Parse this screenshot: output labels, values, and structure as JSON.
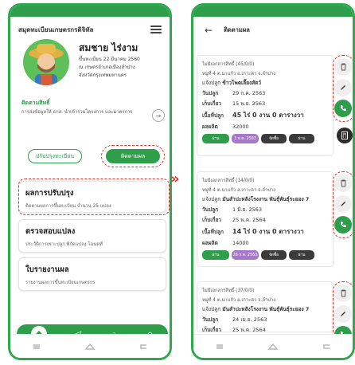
{
  "colors": {
    "brand_green": "#2e9e4a",
    "highlight_red": "#e0342b",
    "chip_purple": "#a778c9",
    "chip_dark": "#3b3b3b"
  },
  "left_screen": {
    "header": {
      "title": "สมุดทะเบียนเกษตรกรดิจิทัล",
      "menu_icon": "hamburger-menu-icon"
    },
    "profile": {
      "name": "สมชาย ไร่งาม",
      "registered": "ขึ้นทะเบียน 22 มีนาคม 2560",
      "farm_line1": "ณ เกษตรอำเภอเมืองลำปาง",
      "farm_line2": "จังหวัดกรุงเทพมหานคร"
    },
    "link_section": {
      "title": "ติดตามสิทธิ์",
      "desc": "การส่งข้อมูลให้ ธกส. นำเข้าร่วมโครงการ และมาตรการ"
    },
    "buttons": {
      "update": "ปรับปรุงทะเบียน",
      "track": "ติดตามผล"
    },
    "cards": [
      {
        "title": "ผลการปรับปรุง",
        "desc": "ติดตามผลการขึ้นทะเบียน จำนวน 25 แปลง"
      },
      {
        "title": "ตรวจสอบแปลง",
        "desc": "ประวัติการเพาะปลูก พิกัดแปลง โฉนดที่"
      },
      {
        "title": "ใบรายงานผล",
        "desc": "รายงานผลการขึ้นทะเบียนเกษตรกร"
      }
    ],
    "tabbar_icons": [
      "home-icon",
      "send-icon",
      "question-icon",
      "bell-icon"
    ]
  },
  "right_screen": {
    "header": {
      "title": "ติดตามผล",
      "back_icon": "back-arrow-icon"
    },
    "labels": {
      "plant_date": "วันปลูก",
      "harvest_date": "เก็บเกี่ยว",
      "area": "เนื้อที่ปลูก",
      "yield": "ผลผลิต"
    },
    "plots": [
      {
        "doc": "ไม่มีเอกสารสิทธิ์ (45/0/0)",
        "address": "หมู่ที่ 4 ต.นาแก้ว อ.เกาะคา จ.ลำปาง",
        "crop_label": "แจ้งปลูก",
        "crop": "ข้าวโพดเลี้ยงสัตว์",
        "plant_date": "29 ก.ค. 2563",
        "harvest_date": "15 พ.ย. 2563",
        "area": "45 ไร่ 0 งาน 0 ตารางวา",
        "yield": "32000",
        "chips": [
          "ผ่าน",
          "1 ธ.ค. 2563",
          "จัดซื้อ",
          "ผ่าน"
        ]
      },
      {
        "doc": "ไม่มีเอกสารสิทธิ์ (14/0/0)",
        "address": "หมู่ที่ 4 ต.นาแก้ว อ.เกาะคา จ.ลำปาง",
        "crop_label": "แจ้งปลูก",
        "crop": "มันสำปะหลังโรงงาน พันธุ์พันธุ์ระยอง 7",
        "plant_date": "1 มิ.ย. 2563",
        "harvest_date": "25 พ.ค. 2564",
        "area": "14 ไร่ 0 งาน 0 ตารางวา",
        "yield": "14000",
        "chips": [
          "ผ่าน",
          "28 ก.ค. 2563",
          "จัดซื้อ",
          "ผ่าน"
        ]
      },
      {
        "doc": "ไม่มีเอกสารสิทธิ์ (37/0/0)",
        "address": "หมู่ที่ 4 ต.นาแก้ว อ.เกาะคา จ.ลำปาง",
        "crop_label": "แจ้งปลูก",
        "crop": "มันสำปะหลังโรงงาน พันธุ์พันธุ์ระยอง 7",
        "plant_date": "24 เม.ย. 2563",
        "harvest_date": "25 พ.ค. 2564"
      }
    ]
  }
}
